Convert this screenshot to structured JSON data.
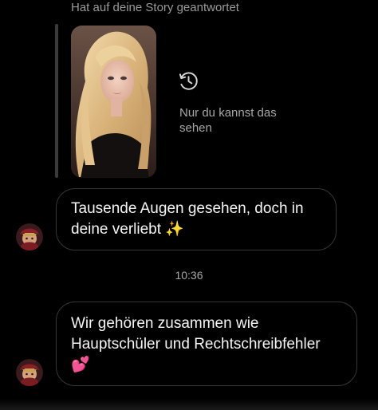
{
  "story": {
    "caption": "Hat auf deine Story geantwortet",
    "private_note": "Nur du kannst das sehen",
    "private_icon": "history-clock-icon"
  },
  "messages": [
    {
      "text": "Tausende Augen gesehen, doch in deine verliebt ✨",
      "avatar_icon": "contact-avatar"
    },
    {
      "text": "Wir gehören zusammen wie Hauptschüler und Rechtschreibfehler 💕",
      "avatar_icon": "contact-avatar"
    }
  ],
  "timestamp": "10:36",
  "colors": {
    "background": "#000000",
    "bubble_border": "#363636",
    "muted_text": "#a8a8a8"
  }
}
